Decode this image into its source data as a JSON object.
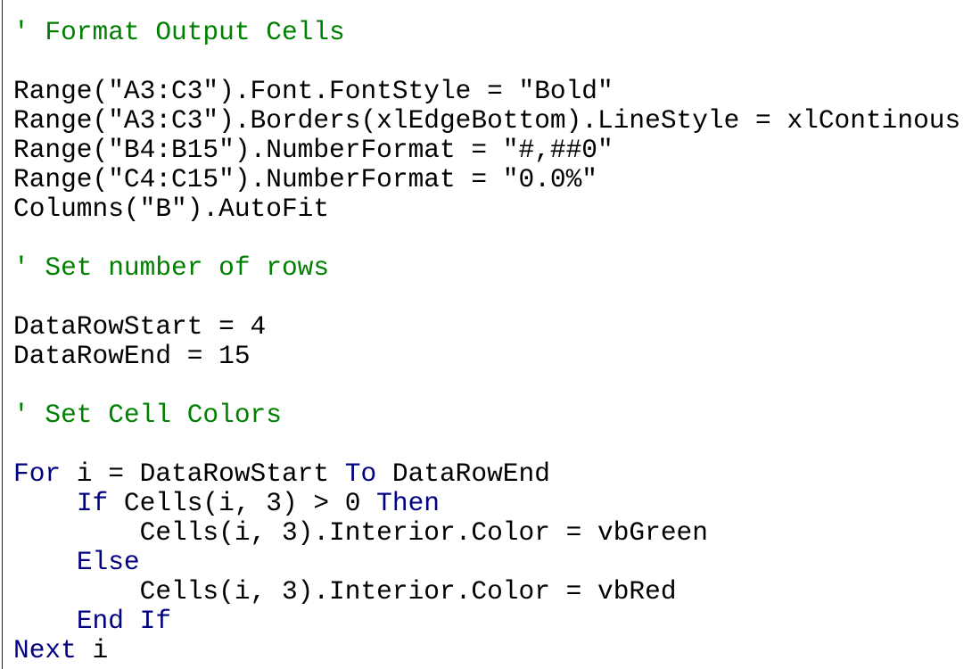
{
  "colors": {
    "keyword": "#000080",
    "comment": "#008000",
    "text": "#000000"
  },
  "code_lines": [
    [
      {
        "t": "' Format Output Cells",
        "k": "cm"
      }
    ],
    [],
    [
      {
        "t": "Range(\"A3:C3\").Font.FontStyle = \"Bold\"",
        "k": "tx"
      }
    ],
    [
      {
        "t": "Range(\"A3:C3\").Borders(xlEdgeBottom).LineStyle = xlContinous",
        "k": "tx"
      }
    ],
    [
      {
        "t": "Range(\"B4:B15\").NumberFormat = \"#,##0\"",
        "k": "tx"
      }
    ],
    [
      {
        "t": "Range(\"C4:C15\").NumberFormat = \"0.0%\"",
        "k": "tx"
      }
    ],
    [
      {
        "t": "Columns(\"B\").AutoFit",
        "k": "tx"
      }
    ],
    [],
    [
      {
        "t": "' Set number of rows",
        "k": "cm"
      }
    ],
    [],
    [
      {
        "t": "DataRowStart = 4",
        "k": "tx"
      }
    ],
    [
      {
        "t": "DataRowEnd = 15",
        "k": "tx"
      }
    ],
    [],
    [
      {
        "t": "' Set Cell Colors",
        "k": "cm"
      }
    ],
    [],
    [
      {
        "t": "For",
        "k": "kw"
      },
      {
        "t": " i = DataRowStart ",
        "k": "tx"
      },
      {
        "t": "To",
        "k": "kw"
      },
      {
        "t": " DataRowEnd",
        "k": "tx"
      }
    ],
    [
      {
        "t": "    ",
        "k": "tx"
      },
      {
        "t": "If",
        "k": "kw"
      },
      {
        "t": " Cells(i, 3) > 0 ",
        "k": "tx"
      },
      {
        "t": "Then",
        "k": "kw"
      }
    ],
    [
      {
        "t": "        Cells(i, 3).Interior.Color = vbGreen",
        "k": "tx"
      }
    ],
    [
      {
        "t": "    ",
        "k": "tx"
      },
      {
        "t": "Else",
        "k": "kw"
      }
    ],
    [
      {
        "t": "        Cells(i, 3).Interior.Color = vbRed",
        "k": "tx"
      }
    ],
    [
      {
        "t": "    ",
        "k": "tx"
      },
      {
        "t": "End If",
        "k": "kw"
      }
    ],
    [
      {
        "t": "Next",
        "k": "kw"
      },
      {
        "t": " i",
        "k": "tx"
      }
    ]
  ]
}
